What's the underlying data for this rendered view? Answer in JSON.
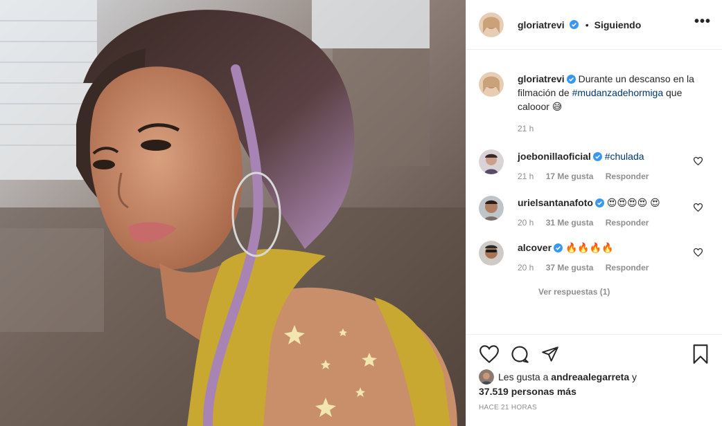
{
  "post": {
    "author": "gloriatrevi",
    "follow_status": "Siguiendo",
    "dot": "•",
    "more_glyph": "•••"
  },
  "caption": {
    "username": "gloriatrevi",
    "text_before": "Durante un descanso en la filmación de",
    "hashtag": "#mudanzadehormiga",
    "text_after": "que calooor 😅",
    "time": "21 h"
  },
  "comments": [
    {
      "username": "joebonillaoficial",
      "text": "#chulada",
      "is_hashtag": true,
      "time": "21 h",
      "likes": "17 Me gusta",
      "reply": "Responder"
    },
    {
      "username": "urielsantanafoto",
      "text": "😍😍😍😍 😍",
      "is_hashtag": false,
      "time": "20 h",
      "likes": "31 Me gusta",
      "reply": "Responder"
    },
    {
      "username": "alcover",
      "text": "🔥🔥🔥🔥",
      "is_hashtag": false,
      "time": "20 h",
      "likes": "37 Me gusta",
      "reply": "Responder"
    }
  ],
  "view_replies": "Ver respuestas (1)",
  "likes": {
    "prefix": "Les gusta a",
    "user": "andreaalegarreta",
    "conj": "y",
    "count": "37.519 personas más"
  },
  "timestamp": "HACE 21 HORAS",
  "colors": {
    "verified": "#3897f0",
    "hashtag": "#00376b",
    "meta": "#8e8e8e",
    "dress": "#c9a832"
  },
  "icons": [
    "verified-icon",
    "heart-icon",
    "comment-icon",
    "share-icon",
    "bookmark-icon",
    "more-icon"
  ]
}
